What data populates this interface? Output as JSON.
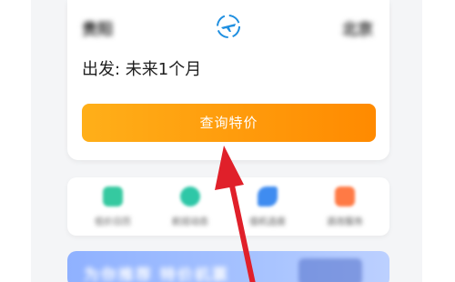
{
  "search_card": {
    "from_city": "贵阳",
    "to_city": "北京",
    "swap_icon": "plane-swap-icon",
    "depart_label": "出发: 未来1个月",
    "query_button": "查询特价"
  },
  "menu": {
    "items": [
      {
        "label": "低价日历",
        "icon": "calendar-icon",
        "color": "#35c9a0"
      },
      {
        "label": "航班动态",
        "icon": "plane-status-icon",
        "color": "#2ec7a7"
      },
      {
        "label": "值机选座",
        "icon": "seat-icon",
        "color": "#3f8cf0"
      },
      {
        "label": "退改服务",
        "icon": "service-icon",
        "color": "#ff7a45"
      }
    ]
  },
  "banner": {
    "text": "为你推荐 特价机票"
  },
  "colors": {
    "button_start": "#ffaf19",
    "button_end": "#ff8a00",
    "arrow": "#e0202a",
    "swap_icon": "#1f8fe0"
  }
}
